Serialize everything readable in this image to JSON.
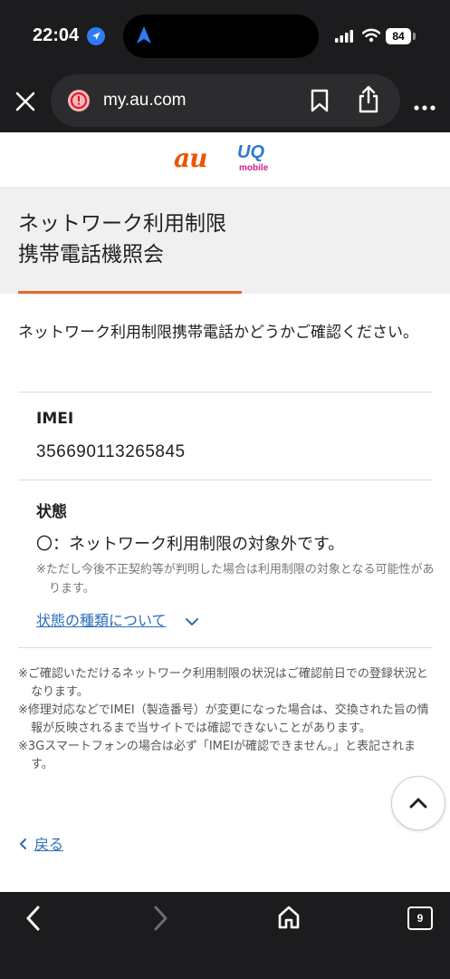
{
  "status_bar": {
    "time": "22:04",
    "battery": "84",
    "icons": [
      "location-icon",
      "navigation-arrow-icon",
      "signal-icon",
      "wifi-icon",
      "battery-icon"
    ]
  },
  "browser": {
    "url": "my.au.com",
    "icons": [
      "close-icon",
      "warning-icon",
      "bookmark-icon",
      "share-icon",
      "more-icon"
    ]
  },
  "logos": {
    "au": "au",
    "uq": "UQ",
    "uq_sub": "mobile",
    "colors": {
      "au": "#eb5505",
      "uq": "#2d7ad2",
      "mobile": "#d81b8c"
    }
  },
  "hero": {
    "title_line1": "ネットワーク利用制限",
    "title_line2": "携帯電話機照会",
    "accent_color": "#e06a2e"
  },
  "intro": "ネットワーク利用制限携帯電話かどうかご確認ください。",
  "result": {
    "imei_label": "IMEI",
    "imei_value": "356690113265845",
    "status_label": "状態",
    "status_value": "〇：ネットワーク利用制限の対象外です。",
    "status_note": "※ただし今後不正契約等が判明した場合は利用制限の対象となる可能性があります。",
    "types_link": "状態の種類について"
  },
  "footnotes": [
    "※ご確認いただけるネットワーク利用制限の状況はご確認前日での登録状況となります。",
    "※修理対応などでIMEI（製造番号）が変更になった場合は、交換された旨の情報が反映されるまで当サイトでは確認できないことがあります。",
    "※3Gスマートフォンの場合は必ず「IMEIが確認できません。」と表記されます。"
  ],
  "back_link": "戻る",
  "toolbar": {
    "tabs_count": "9",
    "icons": [
      "back-arrow-icon",
      "forward-arrow-icon",
      "home-icon",
      "tabs-icon"
    ]
  },
  "link_color": "#2a6ebb"
}
